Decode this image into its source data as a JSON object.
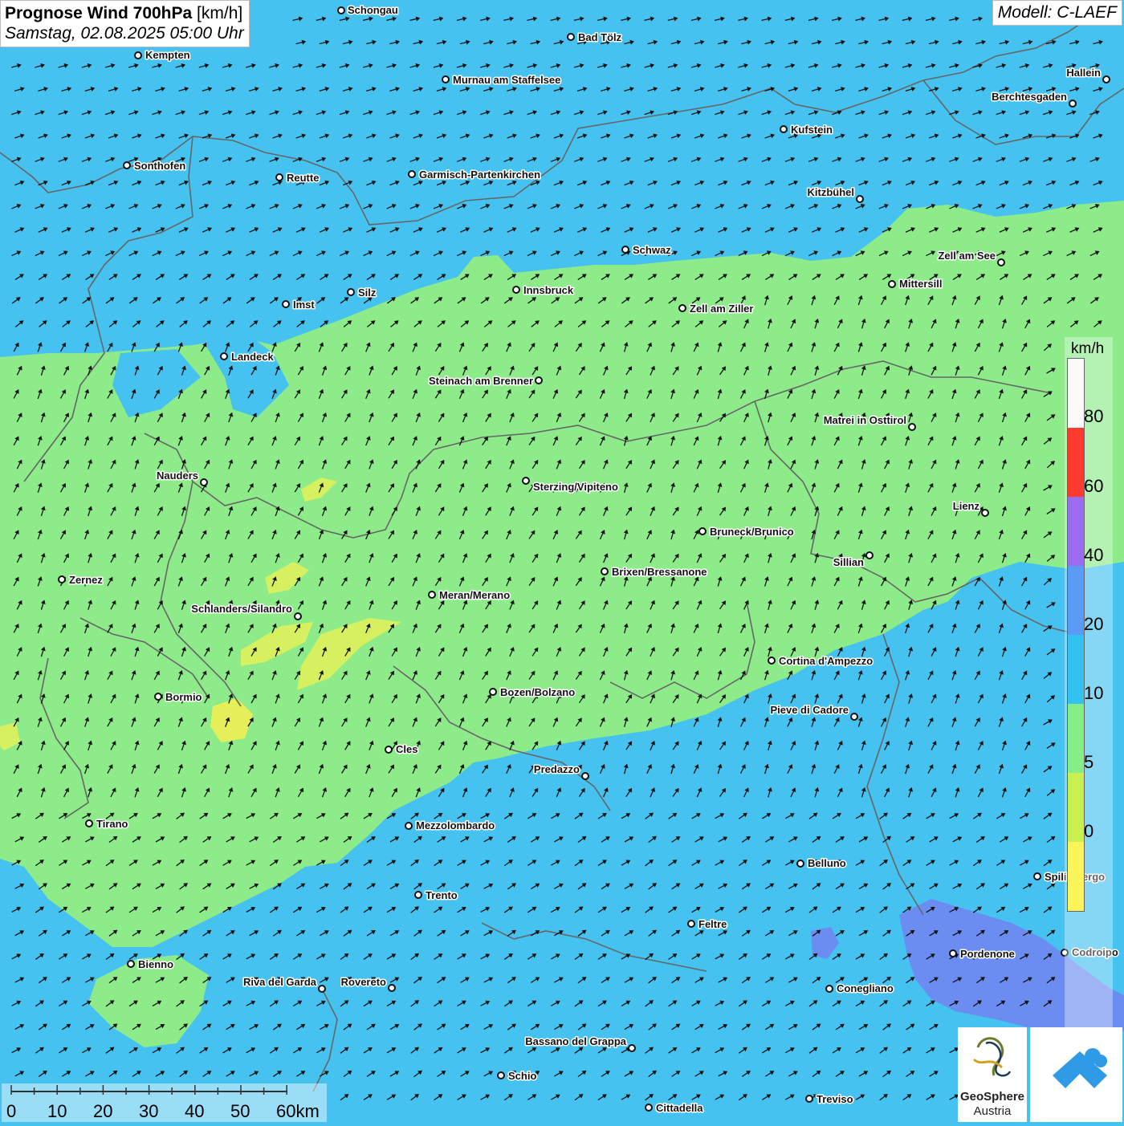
{
  "header": {
    "title_bold": "Prognose Wind 700hPa",
    "title_unit": "[km/h]",
    "subtitle": "Samstag, 02.08.2025 05:00 Uhr",
    "model": "Modell: C-LAEF"
  },
  "legend": {
    "unit": "km/h",
    "levels": [
      "80",
      "60",
      "40",
      "20",
      "10",
      "5",
      "0"
    ],
    "colors": [
      "#fafafa",
      "#ff3b2f",
      "#9b6cf0",
      "#5b9bf5",
      "#33c2f0",
      "#86ee86",
      "#c8f050",
      "#fbf55a"
    ]
  },
  "scalebar": {
    "labels": [
      "0",
      "10",
      "20",
      "30",
      "40",
      "50",
      "60km"
    ]
  },
  "logos": {
    "geosphere_line1": "GeoSphere",
    "geosphere_line2": "Austria"
  },
  "colors": {
    "zone_10_20": "#8deb8a",
    "zone_20_40": "#45c2f0",
    "zone_40_60": "#6b8cf0",
    "zone_5_10": "#d6f060",
    "arrow": "#111111",
    "border": "#666666"
  },
  "cities": [
    {
      "name": "Schongau"
    },
    {
      "name": "Bad Tölz"
    },
    {
      "name": "Kempten"
    },
    {
      "name": "Murnau am Staffelsee"
    },
    {
      "name": "Hallein"
    },
    {
      "name": "Berchtesgaden"
    },
    {
      "name": "Kufstein"
    },
    {
      "name": "Sonthofen"
    },
    {
      "name": "Reutte"
    },
    {
      "name": "Garmisch-Partenkirchen"
    },
    {
      "name": "Kitzbühel"
    },
    {
      "name": "Schwaz"
    },
    {
      "name": "Zell am See"
    },
    {
      "name": "Innsbruck"
    },
    {
      "name": "Mittersill"
    },
    {
      "name": "Imst"
    },
    {
      "name": "Silz"
    },
    {
      "name": "Zell am Ziller"
    },
    {
      "name": "Landeck"
    },
    {
      "name": "Steinach am Brenner"
    },
    {
      "name": "Matrei in Osttirol"
    },
    {
      "name": "Nauders"
    },
    {
      "name": "Sterzing/Vipiteno"
    },
    {
      "name": "Lienz"
    },
    {
      "name": "Bruneck/Brunico"
    },
    {
      "name": "Sillian"
    },
    {
      "name": "Zernez"
    },
    {
      "name": "Brixen/Bressanone"
    },
    {
      "name": "Meran/Merano"
    },
    {
      "name": "Schlanders/Silandro"
    },
    {
      "name": "Cortina d'Ampezzo"
    },
    {
      "name": "Bozen/Bolzano"
    },
    {
      "name": "Bormio"
    },
    {
      "name": "Pieve di Cadore"
    },
    {
      "name": "Cles"
    },
    {
      "name": "Predazzo"
    },
    {
      "name": "Tirano"
    },
    {
      "name": "Mezzolombardo"
    },
    {
      "name": "Belluno"
    },
    {
      "name": "Spilimbergo"
    },
    {
      "name": "Trento"
    },
    {
      "name": "Feltre"
    },
    {
      "name": "Pordenone"
    },
    {
      "name": "Codroipo"
    },
    {
      "name": "Bienno"
    },
    {
      "name": "Riva del Garda"
    },
    {
      "name": "Rovereto"
    },
    {
      "name": "Conegliano"
    },
    {
      "name": "Bassano del Grappa"
    },
    {
      "name": "Schio"
    },
    {
      "name": "Treviso"
    },
    {
      "name": "Cittadella"
    }
  ]
}
